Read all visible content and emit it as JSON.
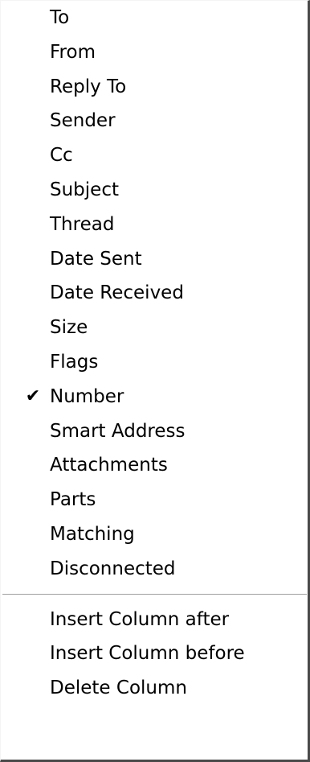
{
  "menu": {
    "column_items": [
      {
        "label": "To",
        "checked": false
      },
      {
        "label": "From",
        "checked": false
      },
      {
        "label": "Reply To",
        "checked": false
      },
      {
        "label": "Sender",
        "checked": false
      },
      {
        "label": "Cc",
        "checked": false
      },
      {
        "label": "Subject",
        "checked": false
      },
      {
        "label": "Thread",
        "checked": false
      },
      {
        "label": "Date Sent",
        "checked": false
      },
      {
        "label": "Date Received",
        "checked": false
      },
      {
        "label": "Size",
        "checked": false
      },
      {
        "label": "Flags",
        "checked": false
      },
      {
        "label": "Number",
        "checked": true
      },
      {
        "label": "Smart Address",
        "checked": false
      },
      {
        "label": "Attachments",
        "checked": false
      },
      {
        "label": "Parts",
        "checked": false
      },
      {
        "label": "Matching",
        "checked": false
      },
      {
        "label": "Disconnected",
        "checked": false
      }
    ],
    "check_glyph": "✔",
    "action_items": [
      {
        "label": "Insert Column after"
      },
      {
        "label": "Insert Column before"
      },
      {
        "label": "Delete Column"
      }
    ]
  }
}
